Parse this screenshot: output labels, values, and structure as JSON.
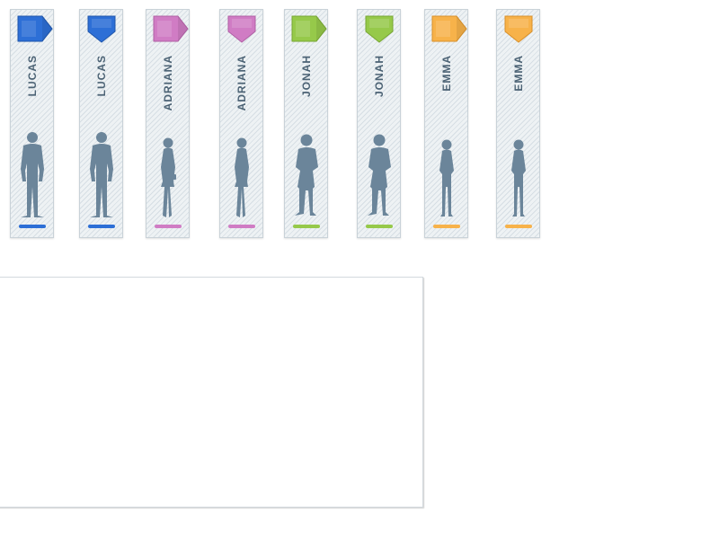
{
  "cards": [
    {
      "name": "LUCAS",
      "tag": "arrow-right",
      "figure": "man",
      "color": "#2d6fd6"
    },
    {
      "name": "LUCAS",
      "tag": "arrow-down",
      "figure": "man",
      "color": "#2d6fd6"
    },
    {
      "name": "ADRIANA",
      "tag": "arrow-right",
      "figure": "woman",
      "color": "#d07cc4"
    },
    {
      "name": "ADRIANA",
      "tag": "arrow-down",
      "figure": "woman",
      "color": "#d07cc4"
    },
    {
      "name": "JONAH",
      "tag": "arrow-right",
      "figure": "boy",
      "color": "#96c94a"
    },
    {
      "name": "JONAH",
      "tag": "arrow-down",
      "figure": "boy",
      "color": "#96c94a"
    },
    {
      "name": "EMMA",
      "tag": "arrow-right",
      "figure": "girl",
      "color": "#f7b24a"
    },
    {
      "name": "EMMA",
      "tag": "arrow-down",
      "figure": "girl",
      "color": "#f7b24a"
    }
  ]
}
